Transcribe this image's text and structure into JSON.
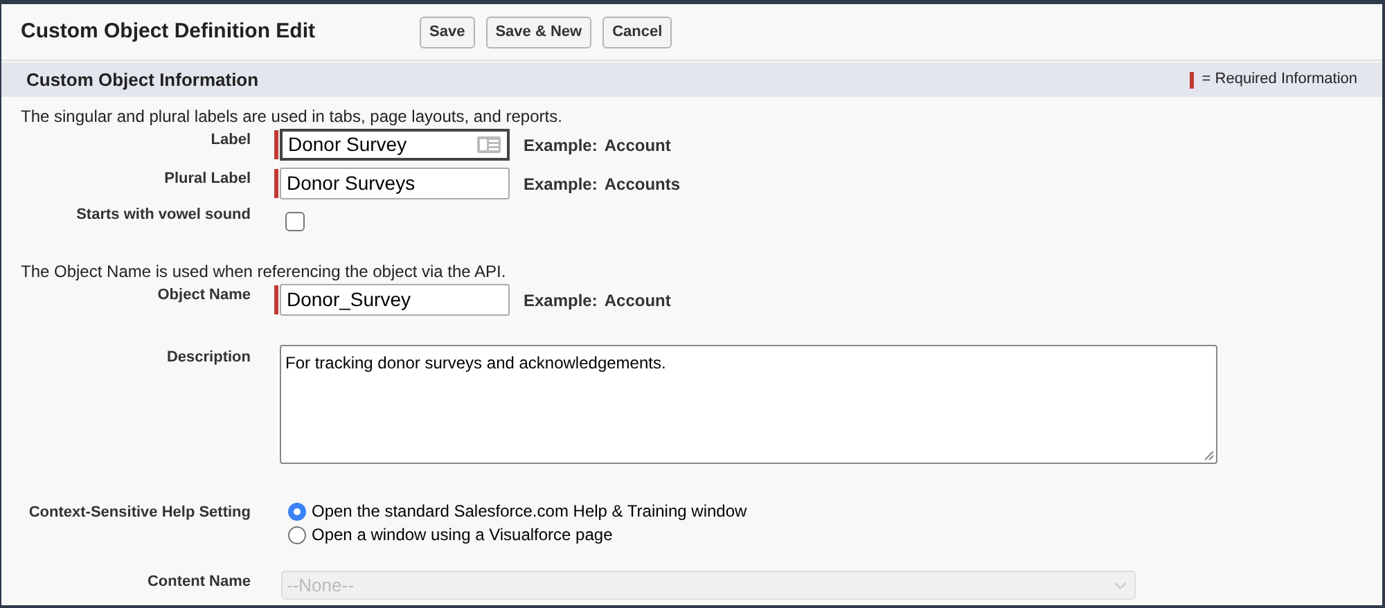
{
  "page_title": "Custom Object Definition Edit",
  "buttons": [
    "Save",
    "Save & New",
    "Cancel"
  ],
  "section": {
    "title": "Custom Object Information",
    "legend": "= Required Information"
  },
  "groups": [
    {
      "intro": "The singular and plural labels are used in tabs, page layouts, and reports.",
      "fields": [
        {
          "kind": "text",
          "label": "Label",
          "value": "Donor Survey",
          "required": true,
          "focused": true,
          "example_label": "Example:",
          "example": "Account"
        },
        {
          "kind": "text",
          "label": "Plural Label",
          "value": "Donor Surveys",
          "required": true,
          "focused": false,
          "example_label": "Example:",
          "example": "Accounts"
        },
        {
          "kind": "checkbox",
          "label": "Starts with vowel sound",
          "checked": false
        }
      ]
    },
    {
      "intro": "The Object Name is used when referencing the object via the API.",
      "fields": [
        {
          "kind": "text",
          "label": "Object Name",
          "value": "Donor_Survey",
          "required": true,
          "focused": false,
          "example_label": "Example:",
          "example": "Account"
        },
        {
          "kind": "textarea",
          "label": "Description",
          "value": "For tracking donor surveys and acknowledgements."
        },
        {
          "kind": "radio",
          "label": "Context-Sensitive Help Setting",
          "options": [
            {
              "label": "Open the standard Salesforce.com Help & Training window",
              "selected": true
            },
            {
              "label": "Open a window using a Visualforce page",
              "selected": false
            }
          ]
        },
        {
          "kind": "select",
          "label": "Content Name",
          "value": "--None--",
          "disabled": true
        }
      ]
    }
  ]
}
